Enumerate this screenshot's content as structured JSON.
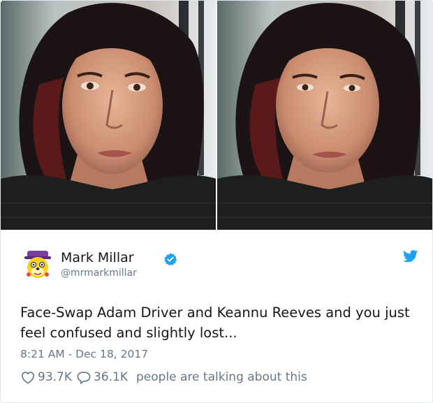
{
  "photos": [
    {
      "name": "face-swap-photo-left",
      "alt": "face-swap photo"
    },
    {
      "name": "face-swap-photo-right",
      "alt": "face-swap photo"
    }
  ],
  "tweet": {
    "author_name": "Mark Millar",
    "handle": "@mrmarkmillar",
    "text": "Face-Swap Adam Driver and Keannu Reeves and you just feel confused and slightly lost...",
    "timestamp": "8:21 AM - Dec 18, 2017"
  },
  "actions": {
    "likes": "93.7K",
    "replies": "36.1K",
    "talking_label": "people are talking about this"
  },
  "icons": {
    "verified": "verified-badge-icon",
    "bird": "twitter-bird-icon",
    "like": "heart-icon",
    "reply": "reply-bubble-icon"
  },
  "colors": {
    "brand_blue": "#1da1f2",
    "text": "#14171a",
    "muted": "#657786"
  }
}
